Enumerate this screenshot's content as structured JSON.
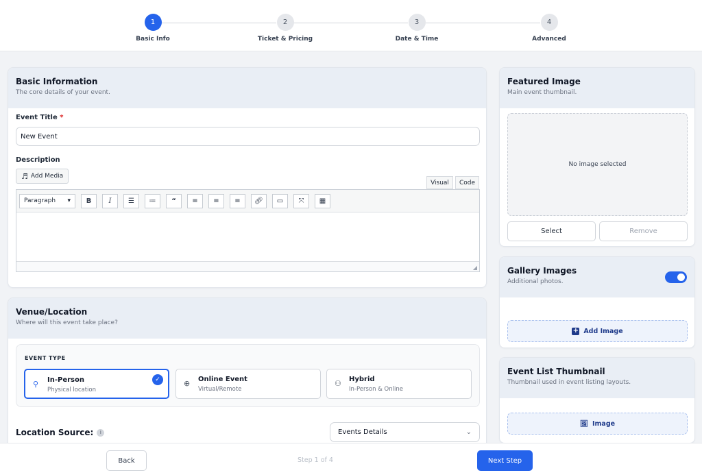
{
  "stepper": {
    "steps": [
      {
        "number": "1",
        "label": "Basic Info"
      },
      {
        "number": "2",
        "label": "Ticket & Pricing"
      },
      {
        "number": "3",
        "label": "Date & Time"
      },
      {
        "number": "4",
        "label": "Advanced"
      }
    ],
    "active_step": 1
  },
  "basic_info": {
    "title": "Basic Information",
    "subtitle": "The core details of your event.",
    "event_title_label": "Event Title",
    "required_mark": "*",
    "event_title_value": "New Event",
    "description_label": "Description",
    "add_media_label": "Add Media",
    "tab_visual": "Visual",
    "tab_code": "Code",
    "format_select": "Paragraph",
    "toolbar_icons": [
      "bold-icon",
      "italic-icon",
      "bullet-list-icon",
      "numbered-list-icon",
      "blockquote-icon",
      "align-left-icon",
      "align-center-icon",
      "align-right-icon",
      "link-icon",
      "read-more-icon",
      "fullscreen-icon",
      "toolbar-toggle-icon"
    ]
  },
  "venue": {
    "title": "Venue/Location",
    "subtitle": "Where will this event take place?",
    "event_type_label": "EVENT TYPE",
    "options": [
      {
        "title": "In-Person",
        "sub": "Physical location",
        "selected": true
      },
      {
        "title": "Online Event",
        "sub": "Virtual/Remote",
        "selected": false
      },
      {
        "title": "Hybrid",
        "sub": "In-Person & Online",
        "selected": false
      }
    ],
    "location_source_label": "Location Source:",
    "location_source_value": "Events Details"
  },
  "featured_image": {
    "title": "Featured Image",
    "subtitle": "Main event thumbnail.",
    "empty_text": "No image selected",
    "select_label": "Select",
    "remove_label": "Remove"
  },
  "gallery": {
    "title": "Gallery Images",
    "subtitle": "Additional photos.",
    "toggle_on": true,
    "add_label": "Add Image"
  },
  "thumbnail": {
    "title": "Event List Thumbnail",
    "subtitle": "Thumbnail used in event listing layouts.",
    "image_label": "Image"
  },
  "footer": {
    "back_label": "Back",
    "step_count": "Step 1 of 4",
    "next_label": "Next Step"
  },
  "colors": {
    "accent": "#2563eb",
    "card_header": "#e9eef5",
    "required": "#dc2626"
  }
}
